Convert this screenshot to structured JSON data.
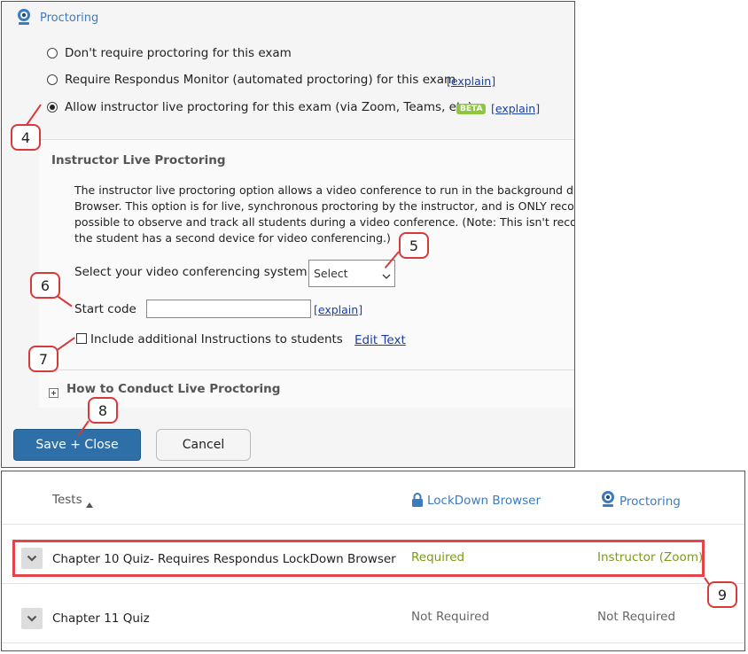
{
  "proctoring_panel": {
    "header_title": "Proctoring",
    "options": [
      {
        "label": "Don't require proctoring for this exam",
        "checked": false
      },
      {
        "label": "Require Respondus Monitor (automated proctoring) for this exam",
        "link": "[explain]",
        "checked": false
      },
      {
        "label": "Allow instructor live proctoring for this exam (via Zoom, Teams, etc)",
        "badge": "BETA",
        "link": "[explain]",
        "checked": true
      }
    ],
    "live_section": {
      "title": "Instructor Live Proctoring",
      "description": "The instructor live proctoring option allows a video conference to run in the background durin Browser. This option is for live, synchronous proctoring by the instructor, and is ONLY recomm possible to observe and track all students during a video conference. (Note: This isn't recomm the student has a second device for video conferencing.)",
      "video_system_label": "Select your video conferencing system",
      "video_system_value": "Select",
      "start_code_label": "Start code",
      "start_code_value": "",
      "start_code_link": "[explain]",
      "include_instructions_label": "Include additional Instructions to students",
      "edit_text_link": "Edit Text",
      "how_to_label": "How to Conduct Live Proctoring"
    },
    "save_label": "Save + Close",
    "cancel_label": "Cancel"
  },
  "callouts": [
    "4",
    "5",
    "6",
    "7",
    "8",
    "9"
  ],
  "tests_table": {
    "headers": {
      "tests": "Tests",
      "lockdown": "LockDown Browser",
      "proctoring": "Proctoring"
    },
    "rows": [
      {
        "name": "Chapter 10 Quiz- Requires Respondus LockDown Browser",
        "lockdown": "Required",
        "proctoring": "Instructor (Zoom)"
      },
      {
        "name": "Chapter 11 Quiz",
        "lockdown": "Not Required",
        "proctoring": "Not Required"
      }
    ]
  },
  "colors": {
    "accent_blue": "#3b7bbf",
    "callout_red": "#d83a3a",
    "status_green": "#7a9a1c",
    "button_blue": "#2f6fa7"
  },
  "icons": [
    "webcam-icon",
    "lock-icon",
    "sort-up-icon",
    "chevron-down-icon",
    "plus-box-icon",
    "select-caret-icon"
  ]
}
